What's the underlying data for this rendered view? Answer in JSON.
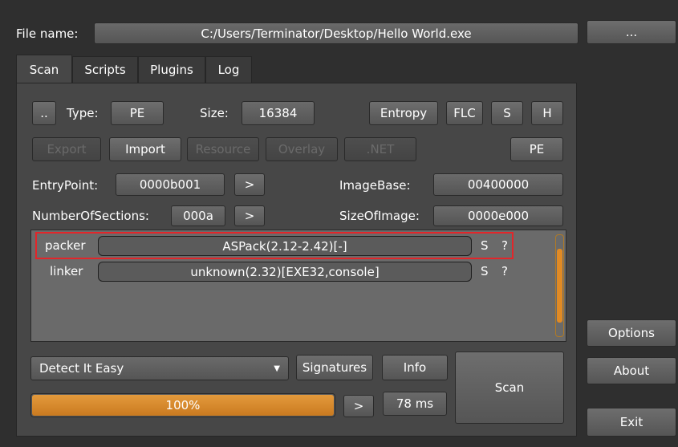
{
  "header": {
    "file_name_label": "File name:",
    "file_path": "C:/Users/Terminator/Desktop/Hello World.exe",
    "browse_label": "..."
  },
  "tabs": [
    {
      "label": "Scan",
      "active": true
    },
    {
      "label": "Scripts",
      "active": false
    },
    {
      "label": "Plugins",
      "active": false
    },
    {
      "label": "Log",
      "active": false
    }
  ],
  "scan": {
    "dotdot_label": "..",
    "type_label": "Type:",
    "type_value": "PE",
    "size_label": "Size:",
    "size_value": "16384",
    "entropy_label": "Entropy",
    "flc_label": "FLC",
    "s_label": "S",
    "h_label": "H",
    "export_label": "Export",
    "import_label": "Import",
    "resource_label": "Resource",
    "overlay_label": "Overlay",
    "net_label": ".NET",
    "pe_label": "PE",
    "entrypoint_label": "EntryPoint:",
    "entrypoint_value": "0000b001",
    "imagebase_label": "ImageBase:",
    "imagebase_value": "00400000",
    "sections_label": "NumberOfSections:",
    "sections_value": "000a",
    "sizeofimage_label": "SizeOfImage:",
    "sizeofimage_value": "0000e000",
    "go_label": ">"
  },
  "results": [
    {
      "type": "packer",
      "value": "ASPack(2.12-2.42)[-]",
      "s": "S",
      "q": "?"
    },
    {
      "type": "linker",
      "value": "unknown(2.32)[EXE32,console]",
      "s": "S",
      "q": "?"
    }
  ],
  "bottom": {
    "engine": "Detect It Easy",
    "signatures_label": "Signatures",
    "info_label": "Info",
    "scan_label": "Scan",
    "progress_text": "100%",
    "progress_fraction": 1.0,
    "next_label": ">",
    "time": "78 ms"
  },
  "side": {
    "options_label": "Options",
    "about_label": "About",
    "exit_label": "Exit"
  },
  "colors": {
    "accent": "#e08a24",
    "highlight": "#e2262a",
    "background": "#2f2f2f"
  }
}
